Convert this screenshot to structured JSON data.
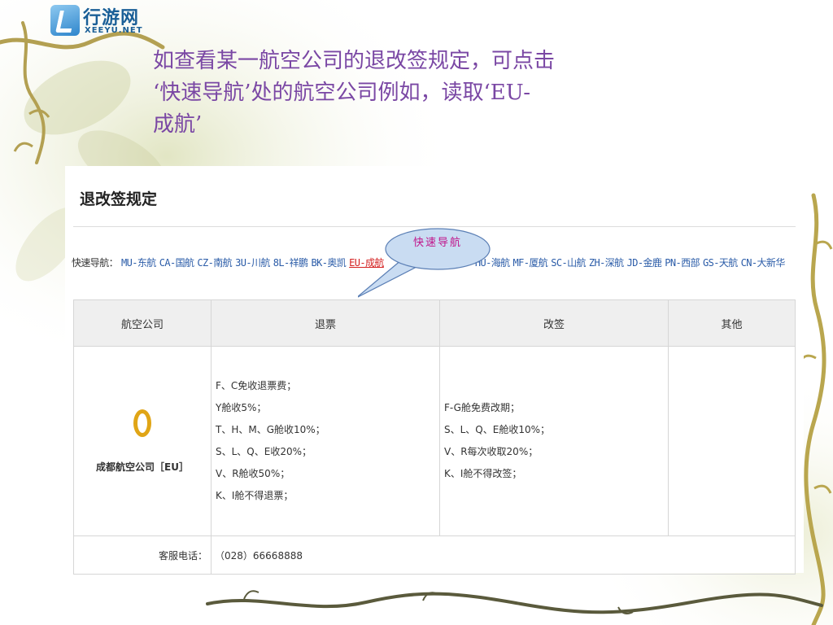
{
  "logo": {
    "name_cn": "行游网",
    "name_en": "XEEYU.NET"
  },
  "slide": {
    "lines": [
      "如查看某一航空公司的退改签规定，可点击",
      "‘快速导航’处的航空公司例如，读取‘EU-",
      "成航’"
    ]
  },
  "panel": {
    "title": "退改签规定",
    "quicknav": {
      "label": "快速导航：",
      "links": [
        "MU-东航",
        "CA-国航",
        "CZ-南航",
        "3U-川航",
        "8L-祥鹏",
        "BK-奥凯",
        "EU-成航",
        "",
        "",
        "HU-海航",
        "MF-厦航",
        "SC-山航",
        "ZH-深航",
        "JD-金鹿",
        "PN-西部",
        "GS-天航",
        "CN-大新华"
      ],
      "active": "EU-成航"
    },
    "table": {
      "headers": [
        "航空公司",
        "退票",
        "改签",
        "其他"
      ],
      "airline_name": "成都航空公司［EU］",
      "refund_rules": [
        "F、C免收退票费；",
        "Y舱收5%；",
        "T、H、M、G舱收10%；",
        "S、L、Q、E收20%；",
        "V、R舱收50%；",
        "K、I舱不得退票；"
      ],
      "change_rules": [
        "F-G舱免费改期；",
        "S、L、Q、E舱收10%；",
        "V、R每次收取20%；",
        "K、I舱不得改签；"
      ],
      "other": "",
      "phone_label": "客服电话：",
      "phone_value": "（028）66668888"
    }
  },
  "callout": {
    "text": "快速导航"
  },
  "colors": {
    "slide_text": "#7a47a4",
    "link": "#2b5ca8",
    "active_link": "#d42020",
    "callout_fill": "#c9dcf2",
    "callout_text": "#c0148a",
    "airline_logo": "#e0a516"
  }
}
